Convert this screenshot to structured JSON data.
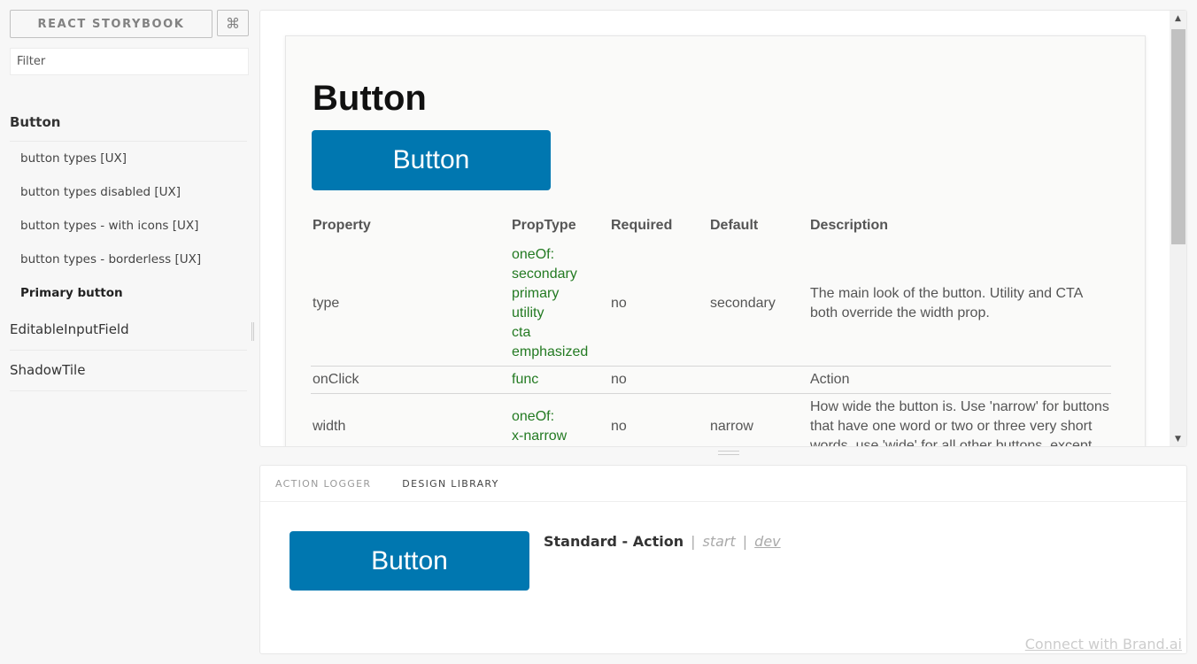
{
  "sidebar": {
    "brand": "REACT STORYBOOK",
    "shortcut_icon": "⌘",
    "filter_placeholder": "Filter",
    "kinds": [
      {
        "name": "Button",
        "stories": [
          "button types [UX]",
          "button types disabled [UX]",
          "button types - with icons [UX]",
          "button types - borderless [UX]",
          "Primary button"
        ],
        "selected_story": "Primary button"
      },
      {
        "name": "EditableInputField"
      },
      {
        "name": "ShadowTile"
      }
    ]
  },
  "preview": {
    "title": "Button",
    "demo_button": "Button",
    "table": {
      "headers": [
        "Property",
        "PropType",
        "Required",
        "Default",
        "Description"
      ],
      "rows": [
        {
          "property": "type",
          "proptype": [
            "oneOf:",
            "secondary",
            "primary",
            "utility",
            "cta",
            "emphasized"
          ],
          "required": "no",
          "default": "secondary",
          "description": "The main look of the button. Utility and CTA both override the width prop."
        },
        {
          "property": "onClick",
          "proptype": [
            "func"
          ],
          "required": "no",
          "default": "",
          "description": "Action"
        },
        {
          "property": "width",
          "proptype": [
            "oneOf:",
            "x-narrow"
          ],
          "required": "no",
          "default": "narrow",
          "description": "How wide the button is. Use 'narrow' for buttons that have one word or two or three very short words, use 'wide' for all other buttons, except"
        }
      ]
    }
  },
  "addons": {
    "tabs": [
      {
        "label": "ACTION LOGGER",
        "active": false
      },
      {
        "label": "DESIGN LIBRARY",
        "active": true
      }
    ],
    "library": {
      "button_label": "Button",
      "title": "Standard - Action",
      "separator": "|",
      "link_start": "start",
      "link_dev": "dev",
      "connect": "Connect with Brand.ai"
    }
  },
  "colors": {
    "button_blue": "#0077b0",
    "proptype_green": "#237a22"
  }
}
